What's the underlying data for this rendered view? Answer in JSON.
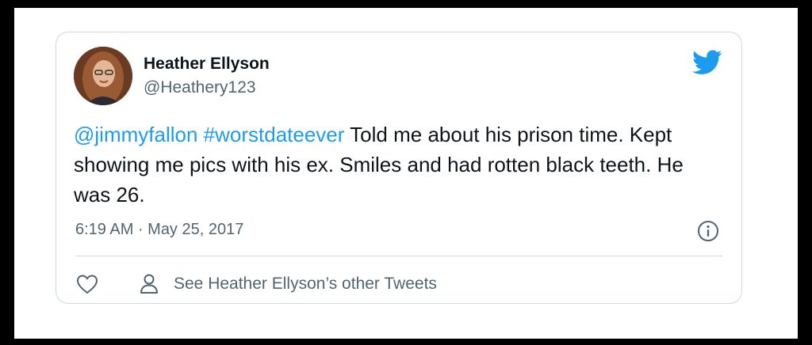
{
  "tweet": {
    "author": {
      "name": "Heather Ellyson",
      "handle": "@Heathery123"
    },
    "text": {
      "mention": "@jimmyfallon",
      "hashtag": "#worstdateever",
      "body": " Told me about his prison time. Kept showing me pics with his ex. Smiles and had rotten black teeth. He was 26."
    },
    "timestamp": "6:19 AM · May 25, 2017",
    "actions": {
      "see_other_tweets": "See Heather Ellyson’s other Tweets"
    },
    "colors": {
      "accent": "#1d9bf0",
      "text": "#0f1419",
      "muted": "#536471",
      "border": "#cfd9de"
    },
    "icons": [
      "twitter-bird-icon",
      "info-icon",
      "heart-icon",
      "person-icon"
    ]
  }
}
